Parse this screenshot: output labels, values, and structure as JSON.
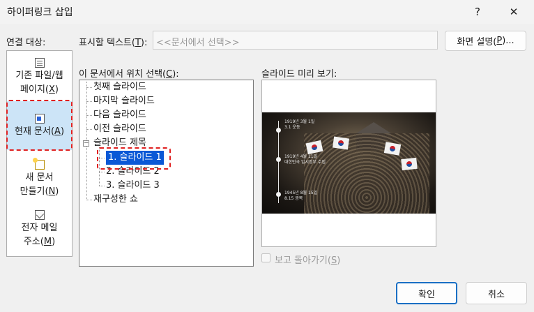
{
  "dialog": {
    "title": "하이퍼링크 삽입",
    "help_label": "?",
    "close_label": "✕"
  },
  "link_to": {
    "label": "연결 대상:",
    "items": [
      {
        "label_line1": "기존 파일/웹",
        "label_line2": "페이지(",
        "mnemonic": "X",
        "suffix": ")",
        "icon": "web-document-icon"
      },
      {
        "label_line1": "",
        "label_line2": "현재 문서(",
        "mnemonic": "A",
        "suffix": ")",
        "icon": "current-document-icon",
        "selected": true
      },
      {
        "label_line1": "새 문서",
        "label_line2": "만들기(",
        "mnemonic": "N",
        "suffix": ")",
        "icon": "new-document-icon"
      },
      {
        "label_line1": "전자 메일",
        "label_line2": "주소(",
        "mnemonic": "M",
        "suffix": ")",
        "icon": "email-icon"
      }
    ]
  },
  "display_text": {
    "label_prefix": "표시할 텍스트(",
    "mnemonic": "T",
    "label_suffix": "):",
    "value": "<<문서에서 선택>>"
  },
  "screentip_button": {
    "prefix": "화면 설명(",
    "mnemonic": "P",
    "suffix": ")..."
  },
  "place_tree": {
    "label_prefix": "이 문서에서 위치 선택(",
    "mnemonic": "C",
    "label_suffix": "):",
    "items": {
      "first": "첫째 슬라이드",
      "last": "마지막 슬라이드",
      "next": "다음 슬라이드",
      "prev": "이전 슬라이드",
      "titles": "슬라이드 제목",
      "s1": "1. 슬라이드 1",
      "s2": "2. 슬라이드 2",
      "s3": "3. 슬라이드 3",
      "custom": "재구성한 쇼"
    },
    "expander_symbol": "−",
    "selected": "s1"
  },
  "preview": {
    "label": "슬라이드 미리 보기:",
    "timeline": [
      {
        "line1": "1919년 3월 1일",
        "line2": "3.1 운동"
      },
      {
        "line1": "1919년 4월 11일",
        "line2": "대한민국 임시정부 수립"
      },
      {
        "line1": "1945년 8월 15일",
        "line2": "8.15 광복"
      }
    ]
  },
  "show_back": {
    "prefix": "보고 돌아가기(",
    "mnemonic": "S",
    "suffix": ")",
    "checked": false
  },
  "buttons": {
    "ok": "확인",
    "cancel": "취소"
  },
  "annotation_color": "#e02020"
}
